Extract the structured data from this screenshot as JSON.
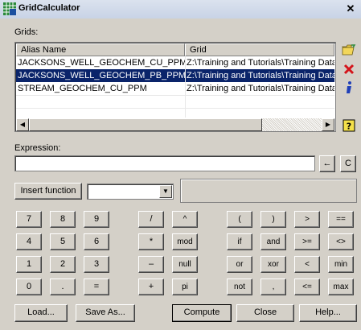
{
  "window": {
    "title": "GridCalculator",
    "close_glyph": "✕"
  },
  "grids": {
    "label": "Grids:",
    "columns": [
      "Alias Name",
      "Grid"
    ],
    "rows": [
      {
        "alias": "JACKSONS_WELL_GEOCHEM_CU_PPM",
        "grid": "Z:\\Training and Tutorials\\Training Data\\A",
        "selected": false
      },
      {
        "alias": "JACKSONS_WELL_GEOCHEM_PB_PPM",
        "grid": "Z:\\Training and Tutorials\\Training Data\\A",
        "selected": true
      },
      {
        "alias": "STREAM_GEOCHEM_CU_PPM",
        "grid": "Z:\\Training and Tutorials\\Training Data\\A",
        "selected": false
      }
    ],
    "scroll_left_glyph": "◀",
    "scroll_right_glyph": "▶"
  },
  "side_buttons": [
    "open-folder-icon",
    "delete-icon",
    "info-icon",
    "help-icon"
  ],
  "expression": {
    "label": "Expression:",
    "value": "",
    "backspace_glyph": "←",
    "clear_label": "C"
  },
  "insert_function": {
    "label": "Insert function",
    "selected": "",
    "arrow_glyph": "▼"
  },
  "keypad": {
    "numbers": [
      [
        "7",
        "8",
        "9"
      ],
      [
        "4",
        "5",
        "6"
      ],
      [
        "1",
        "2",
        "3"
      ],
      [
        "0",
        ".",
        "="
      ]
    ],
    "ops1": [
      [
        "/",
        "^"
      ],
      [
        "*",
        "mod"
      ],
      [
        "–",
        "null"
      ],
      [
        "+",
        "pi"
      ]
    ],
    "ops2": [
      [
        "(",
        ")",
        ">",
        "=="
      ],
      [
        "if",
        "and",
        ">=",
        "<>"
      ],
      [
        "or",
        "xor",
        "<",
        "min"
      ],
      [
        "not",
        ",",
        "<=",
        "max"
      ]
    ]
  },
  "footer": {
    "load": "Load...",
    "save_as": "Save As...",
    "compute": "Compute",
    "close": "Close",
    "help": "Help..."
  },
  "colors": {
    "selection": "#0a246a",
    "face": "#d4d0c8"
  }
}
